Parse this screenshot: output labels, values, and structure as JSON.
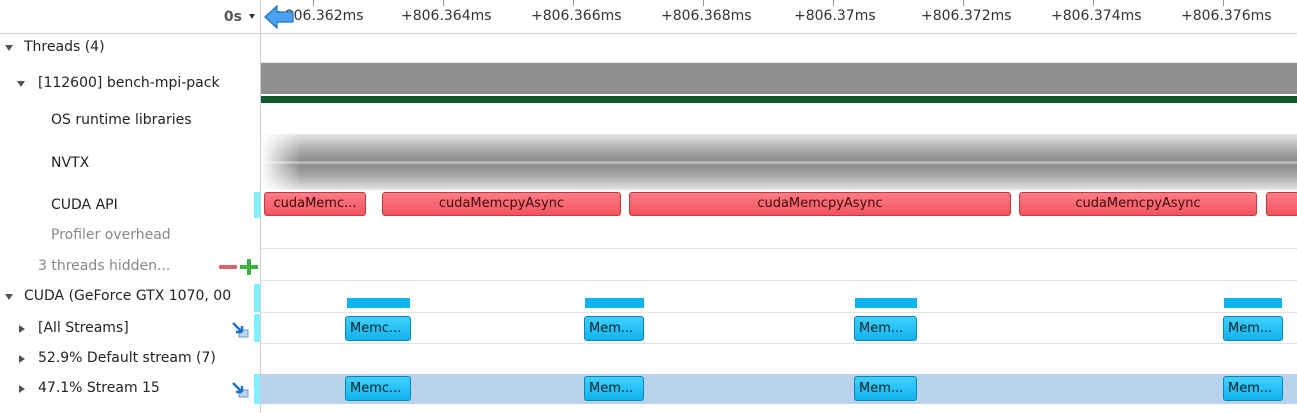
{
  "header": {
    "zero_label": "0s",
    "ticks": [
      "+806.362ms",
      "+806.364ms",
      "+806.366ms",
      "+806.368ms",
      "+806.37ms",
      "+806.372ms",
      "+806.374ms",
      "+806.376ms"
    ]
  },
  "tree": {
    "threads": "Threads (4)",
    "process": "[112600] bench-mpi-pack",
    "os_runtime": "OS runtime libraries",
    "nvtx": "NVTX",
    "cuda_api": "CUDA API",
    "profiler_overhead": "Profiler overhead",
    "hidden": "3 threads hidden...",
    "cuda_device": "CUDA (GeForce GTX 1070, 00",
    "all_streams": "[All Streams]",
    "default_stream": "52.9% Default stream (7)",
    "stream15": "47.1% Stream 15"
  },
  "events": {
    "api": [
      "cudaMemc...",
      "cudaMemcpyAsync",
      "cudaMemcpyAsync",
      "cudaMemcpyAsync"
    ],
    "mem_all": [
      "Memc...",
      "Mem...",
      "Mem...",
      "Mem..."
    ],
    "mem_s15": [
      "Memc...",
      "Mem...",
      "Mem...",
      "Mem..."
    ]
  },
  "colors": {
    "api": "#f2545e",
    "memcpy": "#11b3ee",
    "selection": "#b9d3ec",
    "thread_bar": "#0e5a2a"
  },
  "icons": [
    "menu-dropdown-icon",
    "scroll-left-arrow-icon",
    "collapse-minus-icon",
    "expand-plus-icon",
    "pin-arrow-icon"
  ]
}
